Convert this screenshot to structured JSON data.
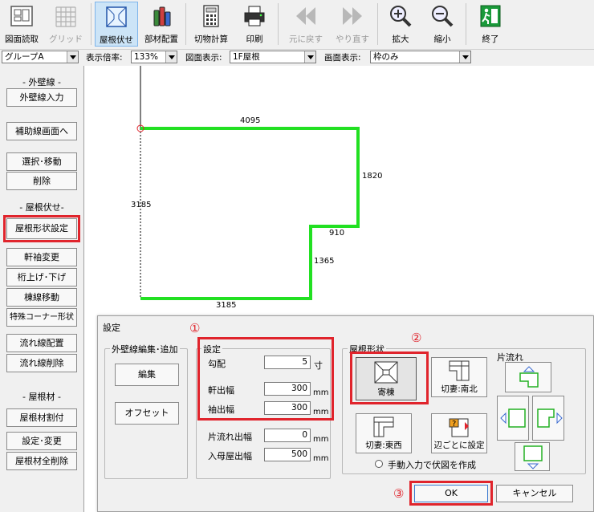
{
  "toolbar": {
    "buttons": [
      {
        "label": "図面読取"
      },
      {
        "label": "グリッド"
      },
      {
        "label": "屋根伏せ"
      },
      {
        "label": "部材配置"
      },
      {
        "label": "切物計算"
      },
      {
        "label": "印刷"
      },
      {
        "label": "元に戻す"
      },
      {
        "label": "やり直す"
      },
      {
        "label": "拡大"
      },
      {
        "label": "縮小"
      },
      {
        "label": "終了"
      }
    ]
  },
  "dropbar": {
    "group_value": "グループA",
    "zoom_label": "表示倍率:",
    "zoom_value": "133%",
    "view_label": "図面表示:",
    "view_value": "1F屋根",
    "screen_label": "画面表示:",
    "screen_value": "枠のみ"
  },
  "sidepanel": {
    "wall_heading": "- 外壁線 -",
    "wall_input": "外壁線入力",
    "aux_screen": "補助線画面へ",
    "select_move": "選択･移動",
    "delete": "削除",
    "roof_heading": "- 屋根伏せ-",
    "roof_shape": "屋根形状設定",
    "eave_change": "軒袖変更",
    "beam_updown": "桁上げ･下げ",
    "ridge_move": "棟線移動",
    "special_corner": "特殊コーナー形状",
    "flow_place": "流れ線配置",
    "flow_delete": "流れ線削除",
    "material_heading": "- 屋根材 -",
    "material_alloc": "屋根材割付",
    "settings_change": "設定･変更",
    "material_delete_all": "屋根材全削除"
  },
  "canvas": {
    "dim_top": "4095",
    "dim_right": "1820",
    "dim_step": "910",
    "dim_right2": "1365",
    "dim_left": "3185",
    "dim_bottom": "3185"
  },
  "dialog": {
    "title": "設定",
    "wall_edit_group": "外壁線編集･追加",
    "edit_button": "編集",
    "offset_button": "オフセット",
    "settings_group": "設定",
    "pitch_label": "勾配",
    "pitch_value": "5",
    "pitch_unit": "寸",
    "eave_label": "軒出幅",
    "eave_value": "300",
    "sleeve_label": "袖出幅",
    "sleeve_value": "300",
    "shed_label": "片流れ出幅",
    "shed_value": "0",
    "gable_label": "入母屋出幅",
    "gable_value": "500",
    "mm": "mm",
    "roof_shape_group": "屋根形状",
    "hip": "寄棟",
    "gable_ns": "切妻:南北",
    "gable_ew": "切妻:東西",
    "per_edge": "辺ごとに設定",
    "shed_group": "片流れ",
    "manual_radio": "手動入力で伏図を作成",
    "ok": "OK",
    "cancel": "キャンセル"
  },
  "annotations": {
    "n1": "①",
    "n2": "②",
    "n3": "③"
  },
  "colors": {
    "highlight_red": "#e0242c",
    "roof_line_green": "#22e022",
    "selected_blue": "#cce4f7"
  }
}
